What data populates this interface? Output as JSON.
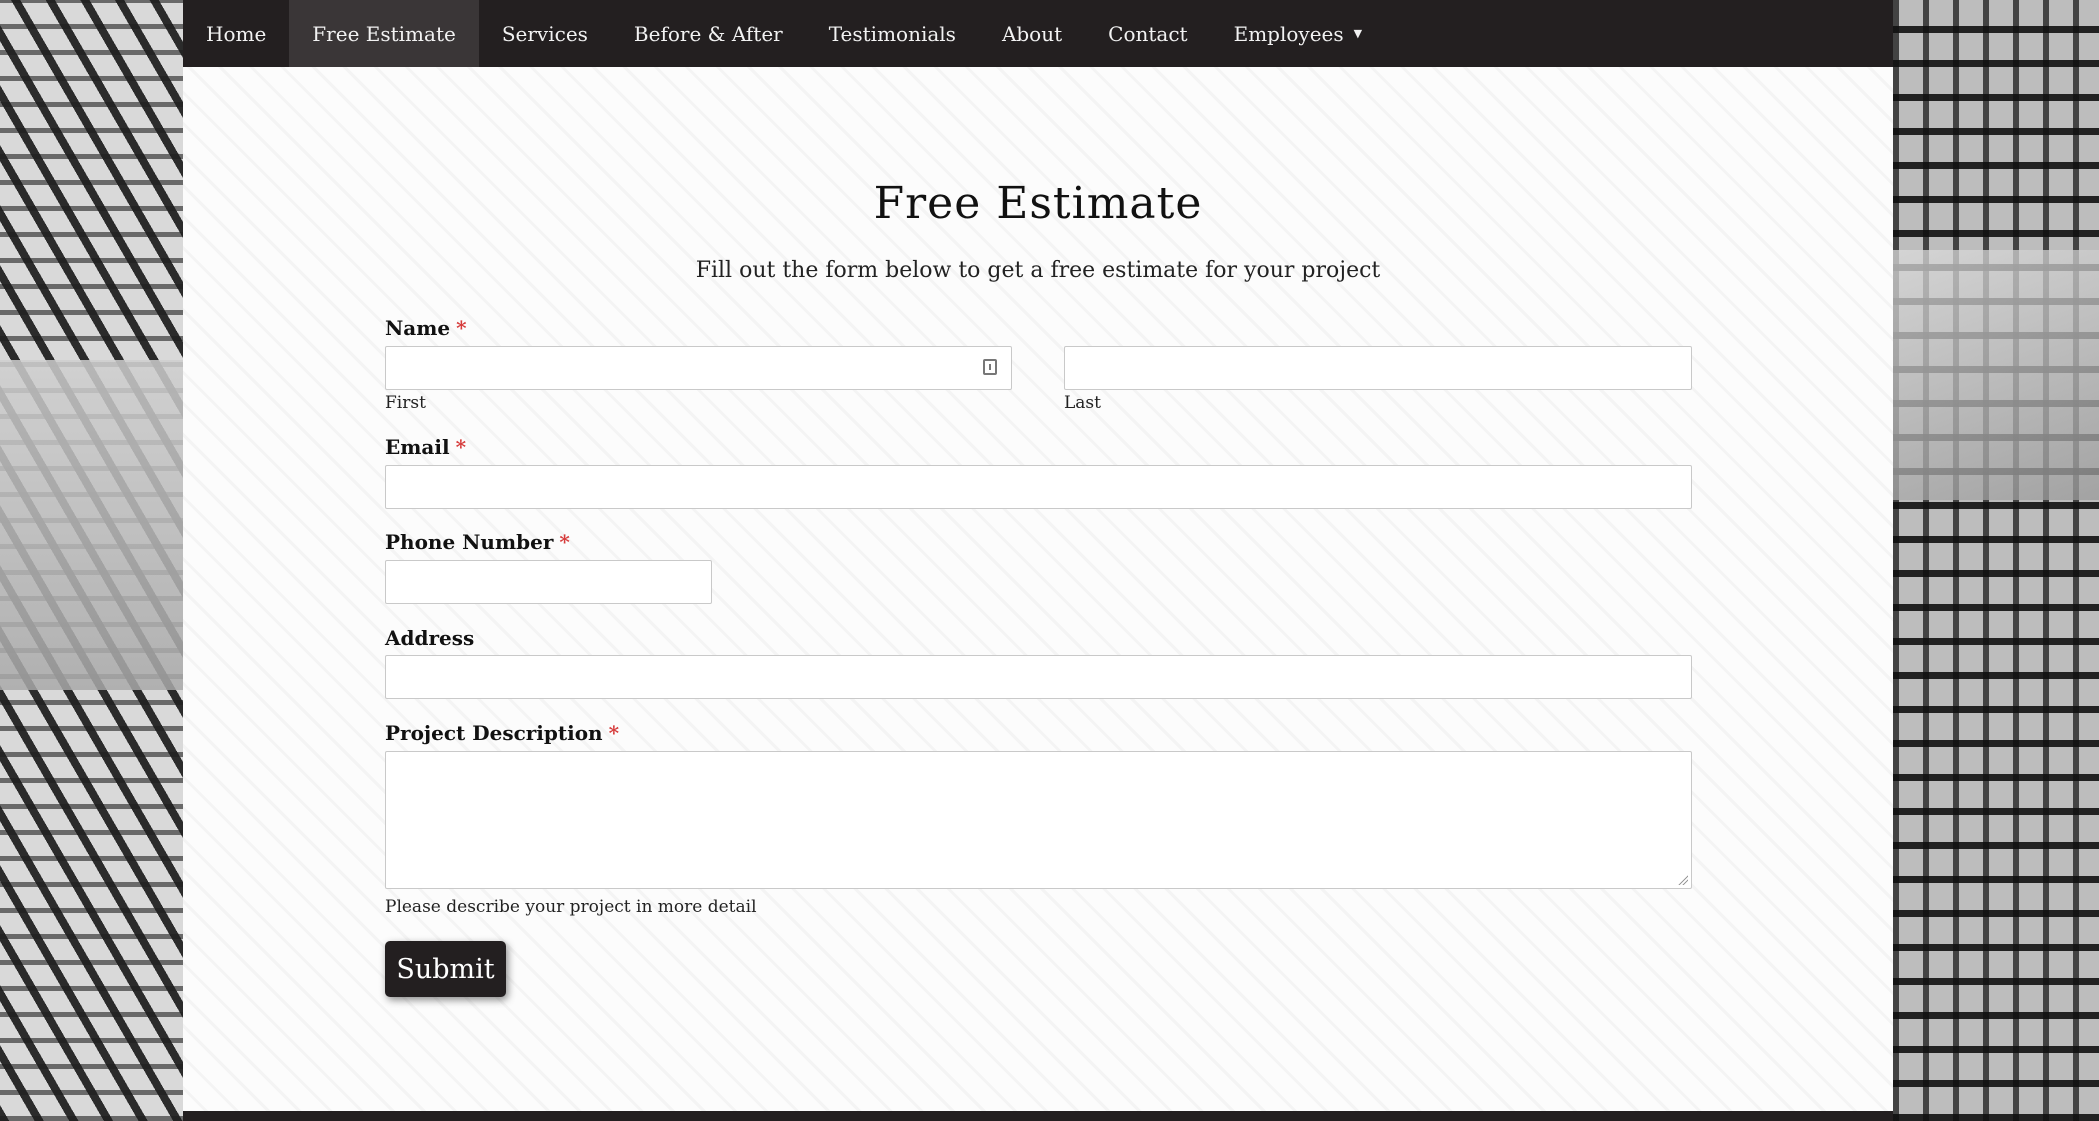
{
  "nav": {
    "items": [
      {
        "label": "Home"
      },
      {
        "label": "Free Estimate"
      },
      {
        "label": "Services"
      },
      {
        "label": "Before & After"
      },
      {
        "label": "Testimonials"
      },
      {
        "label": "About"
      },
      {
        "label": "Contact"
      },
      {
        "label": "Employees"
      }
    ],
    "active": "Free Estimate",
    "dropdown_caret": "▼"
  },
  "form": {
    "title": "Free Estimate",
    "subtitle": "Fill out the form below to get a free estimate for your project",
    "required_mark": "*",
    "name": {
      "label": "Name",
      "first_sublabel": "First",
      "last_sublabel": "Last",
      "first_value": "",
      "last_value": ""
    },
    "email": {
      "label": "Email",
      "value": ""
    },
    "phone": {
      "label": "Phone Number",
      "value": ""
    },
    "address": {
      "label": "Address",
      "value": ""
    },
    "description": {
      "label": "Project Description",
      "value": "",
      "help": "Please describe your project in more detail"
    },
    "submit_label": "Submit"
  },
  "colors": {
    "navbar": "#231f20",
    "required": "#d63b3b",
    "button": "#231f20"
  }
}
